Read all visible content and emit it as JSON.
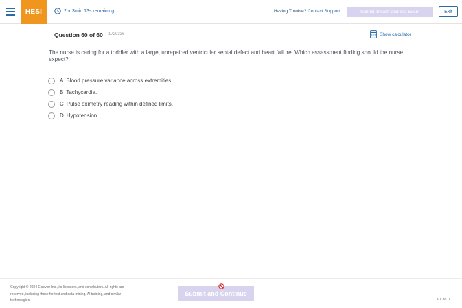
{
  "header": {
    "logo": "HESI",
    "timer": "2hr 3min 13s remaining",
    "trouble_text": "Having Trouble?",
    "contact_link": "Contact Support",
    "submit_exam_label": "Submit answer and exit Exam",
    "exit_label": "Exit"
  },
  "question_bar": {
    "question_number": "Question 60 of 60",
    "question_id": "1729336",
    "calculator_label": "Show calculator"
  },
  "question": {
    "stem": "The nurse is caring for a toddler with a large, unrepaired ventricular septal defect and heart failure. Which assessment finding should the nurse expect?",
    "options": [
      {
        "letter": "A",
        "text": "Blood pressure variance across extremities."
      },
      {
        "letter": "B",
        "text": "Tachycardia."
      },
      {
        "letter": "C",
        "text": "Pulse oximetry reading within defined limits."
      },
      {
        "letter": "D",
        "text": "Hypotension."
      }
    ]
  },
  "footer": {
    "copyright": "Copyright © 2024 Elsevier Inc., its licensors, and contributors. All rights are reserved, including those for text and data mining, AI training, and similar technologies.",
    "submit_continue_label": "Submit and Continue",
    "version": "v1.36.0"
  },
  "colors": {
    "brand_orange": "#f0961e",
    "link_blue": "#2a6ba8",
    "disabled_purple": "#d8d4ef"
  }
}
